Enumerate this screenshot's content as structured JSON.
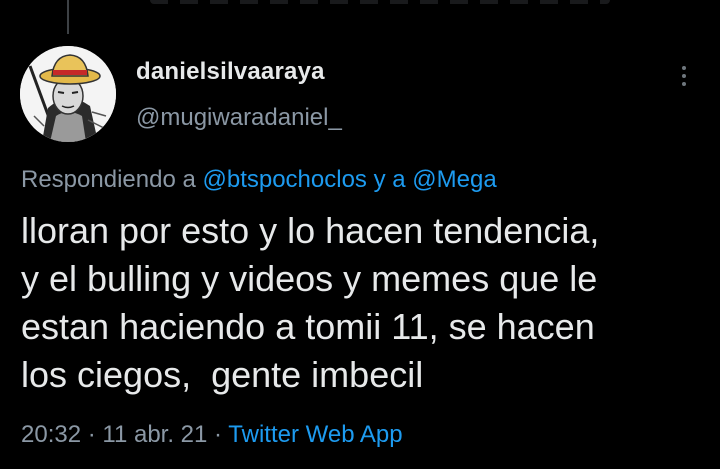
{
  "tweet": {
    "author": {
      "display_name": "danielsilvaaraya",
      "handle": "@mugiwaradaniel_"
    },
    "reply_to": {
      "prefix": "Respondiendo a ",
      "mention_1": "@btspochoclos",
      "connector": " y a ",
      "mention_2": "@Mega"
    },
    "text": "lloran por esto y lo hacen tendencia,\ny el bulling y videos y memes que le\nestan haciendo a tomii 11, se hacen\nlos ciegos,  gente imbecil",
    "meta": {
      "time": "20:32",
      "separator_1": " · ",
      "date": "11 abr. 21",
      "separator_2": " · ",
      "source": "Twitter Web App"
    }
  },
  "icons": {
    "more": "more-vertical-icon"
  },
  "colors": {
    "background": "#000000",
    "text_primary": "#e7e9ea",
    "text_secondary": "#8b98a5",
    "accent": "#1d9bf0"
  }
}
